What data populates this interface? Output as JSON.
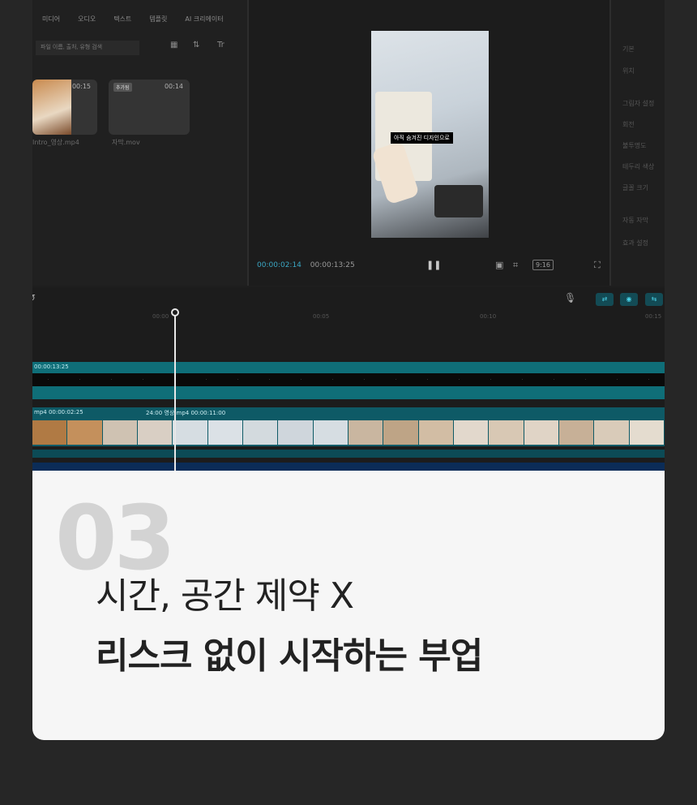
{
  "top_menu": [
    "미디어",
    "오디오",
    "텍스트",
    "템플릿",
    "AI 크리에이터"
  ],
  "media": {
    "search_placeholder": "파일 이름, 출처, 유형 검색",
    "thumbs": [
      {
        "duration": "00:15",
        "name": "Intro_영상.mp4"
      },
      {
        "duration": "00:14",
        "name": "자막.mov",
        "tag": "추가됨"
      }
    ]
  },
  "preview": {
    "caption": "아직 숨겨진 디자인으로",
    "time_current": "00:00:02:14",
    "time_total": "00:00:13:25",
    "ratio_label": "9:16"
  },
  "properties": [
    "기본",
    "위치",
    "그림자 설정",
    "회전",
    "불투명도",
    "테두리 색상",
    "글꼴 크기",
    "자동 자막",
    "효과 설정"
  ],
  "timeline": {
    "ruler_labels": [
      "00:00",
      "00:05",
      "00:10",
      "00:15"
    ],
    "caption_track_time": "00:00:13:25",
    "video_clip_1": "mp4  00:00:02:25",
    "video_clip_2": "24:00 영상.mp4  00:00:11:00"
  },
  "card": {
    "step_number": "03",
    "headline_line1": "시간, 공간 제약 X",
    "headline_line2": "리스크 없이 시작하는 부업"
  },
  "colors": {
    "accent": "#3ba7c4",
    "track_teal": "#0f6e78",
    "card_bg": "#f6f6f6"
  }
}
